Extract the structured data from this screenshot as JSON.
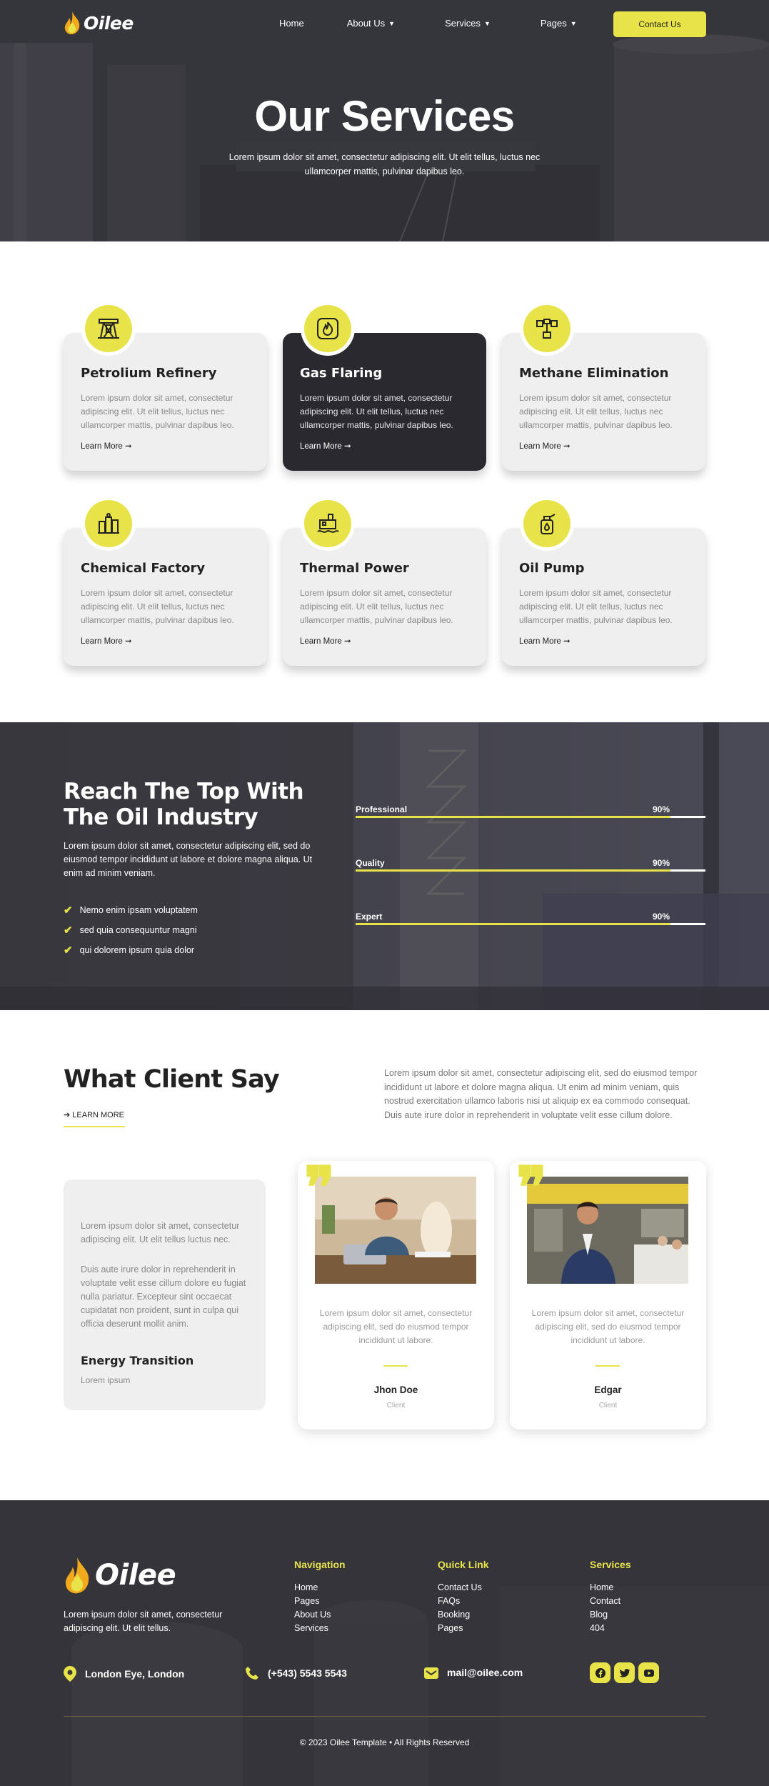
{
  "brand": {
    "name": "Oilee",
    "accent": "#e9e34a",
    "dark": "#2b2930"
  },
  "nav": {
    "items": [
      {
        "label": "Home",
        "dropdown": false
      },
      {
        "label": "About Us",
        "dropdown": true
      },
      {
        "label": "Services",
        "dropdown": true
      },
      {
        "label": "Pages",
        "dropdown": true
      }
    ],
    "contact_label": "Contact Us"
  },
  "hero": {
    "title": "Our Services",
    "subtitle": "Lorem ipsum dolor sit amet, consectetur adipiscing elit. Ut elit tellus, luctus nec ullamcorper mattis, pulvinar dapibus leo."
  },
  "services": [
    {
      "title": "Petrolium Refinery",
      "text": "Lorem ipsum dolor sit amet, consectetur adipiscing elit. Ut elit tellus, luctus nec ullamcorper mattis, pulvinar dapibus leo.",
      "link": "Learn More",
      "icon": "refinery-icon",
      "active": false
    },
    {
      "title": "Gas Flaring",
      "text": "Lorem ipsum dolor sit amet, consectetur adipiscing elit. Ut elit tellus, luctus nec ullamcorper mattis, pulvinar dapibus leo.",
      "link": "Learn More",
      "icon": "flame-icon",
      "active": true
    },
    {
      "title": "Methane Elimination",
      "text": "Lorem ipsum dolor sit amet, consectetur adipiscing elit. Ut elit tellus, luctus nec ullamcorper mattis, pulvinar dapibus leo.",
      "link": "Learn More",
      "icon": "valve-icon",
      "active": false
    },
    {
      "title": "Chemical Factory",
      "text": "Lorem ipsum dolor sit amet, consectetur adipiscing elit. Ut elit tellus, luctus nec ullamcorper mattis, pulvinar dapibus leo.",
      "link": "Learn More",
      "icon": "factory-icon",
      "active": false
    },
    {
      "title": "Thermal Power",
      "text": "Lorem ipsum dolor sit amet, consectetur adipiscing elit. Ut elit tellus, luctus nec ullamcorper mattis, pulvinar dapibus leo.",
      "link": "Learn More",
      "icon": "power-plant-icon",
      "active": false
    },
    {
      "title": "Oil Pump",
      "text": "Lorem ipsum dolor sit amet, consectetur adipiscing elit. Ut elit tellus, luctus nec ullamcorper mattis, pulvinar dapibus leo.",
      "link": "Learn More",
      "icon": "oil-pump-icon",
      "active": false
    }
  ],
  "skills": {
    "title": "Reach The Top With The Oil Industry",
    "description": "Lorem ipsum dolor sit amet, consectetur adipiscing elit, sed do eiusmod tempor incididunt ut labore et dolore magna aliqua. Ut enim ad minim veniam.",
    "checks": [
      "Nemo enim ipsam voluptatem",
      "sed quia consequuntur magni",
      "qui dolorem ipsum quia dolor"
    ],
    "bars": [
      {
        "label": "Professional",
        "percent_label": "90%",
        "value": 0.9
      },
      {
        "label": "Quality",
        "percent_label": "90%",
        "value": 0.9
      },
      {
        "label": "Expert",
        "percent_label": "90%",
        "value": 0.9
      }
    ]
  },
  "clients": {
    "title": "What Client Say",
    "link": "LEARN MORE",
    "description": "Lorem ipsum dolor sit amet, consectetur adipiscing elit, sed do eiusmod tempor incididunt ut labore et dolore magna aliqua. Ut enim ad minim veniam, quis nostrud exercitation ullamco laboris nisi ut aliquip ex ea commodo consequat. Duis aute irure dolor in reprehenderit in voluptate velit esse cillum dolore.",
    "info": {
      "p1": "Lorem ipsum dolor sit amet, consectetur adipiscing elit. Ut elit tellus luctus nec.",
      "p2": "Duis aute irure dolor in reprehenderit in voluptate velit esse cillum dolore eu fugiat nulla pariatur. Excepteur sint occaecat cupidatat non proident, sunt in culpa qui officia deserunt mollit anim.",
      "title": "Energy Transition",
      "sub": "Lorem ipsum"
    },
    "testimonials": [
      {
        "text": "Lorem ipsum dolor sit amet, consectetur adipiscing elit, sed do eiusmod tempor incididunt ut labore.",
        "name": "Jhon Doe",
        "role": "Client"
      },
      {
        "text": "Lorem ipsum dolor sit amet, consectetur adipiscing elit, sed do eiusmod tempor incididunt ut labore.",
        "name": "Edgar",
        "role": "Client"
      }
    ]
  },
  "footer": {
    "about": "Lorem ipsum dolor sit amet, consectetur adipiscing elit. Ut elit tellus.",
    "columns": [
      {
        "title": "Navigation",
        "links": [
          "Home",
          "Pages",
          "About Us",
          "Services"
        ]
      },
      {
        "title": "Quick Link",
        "links": [
          "Contact Us",
          "FAQs",
          "Booking",
          "Pages"
        ]
      },
      {
        "title": "Services",
        "links": [
          "Home",
          "Contact",
          "Blog",
          "404"
        ]
      }
    ],
    "contacts": [
      {
        "icon": "location-pin-icon",
        "text": "London Eye, London"
      },
      {
        "icon": "phone-icon",
        "text": "(+543) 5543 5543"
      },
      {
        "icon": "mail-icon",
        "text": "mail@oilee.com"
      }
    ],
    "social": [
      "facebook-icon",
      "twitter-icon",
      "youtube-icon"
    ],
    "copyright": "© 2023 Oilee Template • All Rights Reserved"
  }
}
